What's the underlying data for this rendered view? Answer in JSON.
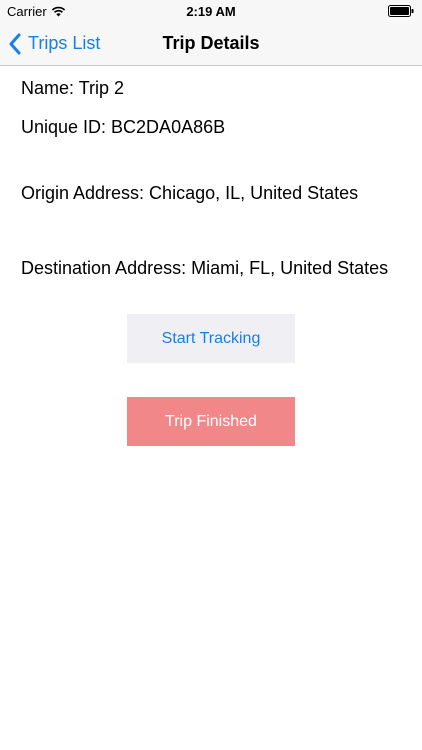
{
  "status_bar": {
    "carrier": "Carrier",
    "time": "2:19 AM"
  },
  "nav": {
    "back_label": "Trips List",
    "title": "Trip Details",
    "accent_color": "#1a7ee8"
  },
  "trip": {
    "name_line": "Name: Trip 2",
    "id_line": "Unique ID: BC2DA0A86B",
    "origin_line": "Origin Address: Chicago, IL, United States",
    "destination_line": "Destination Address: Miami, FL, United States"
  },
  "actions": {
    "start_label": "Start Tracking",
    "finished_label": "Trip Finished",
    "finished_color": "#f2878a"
  }
}
